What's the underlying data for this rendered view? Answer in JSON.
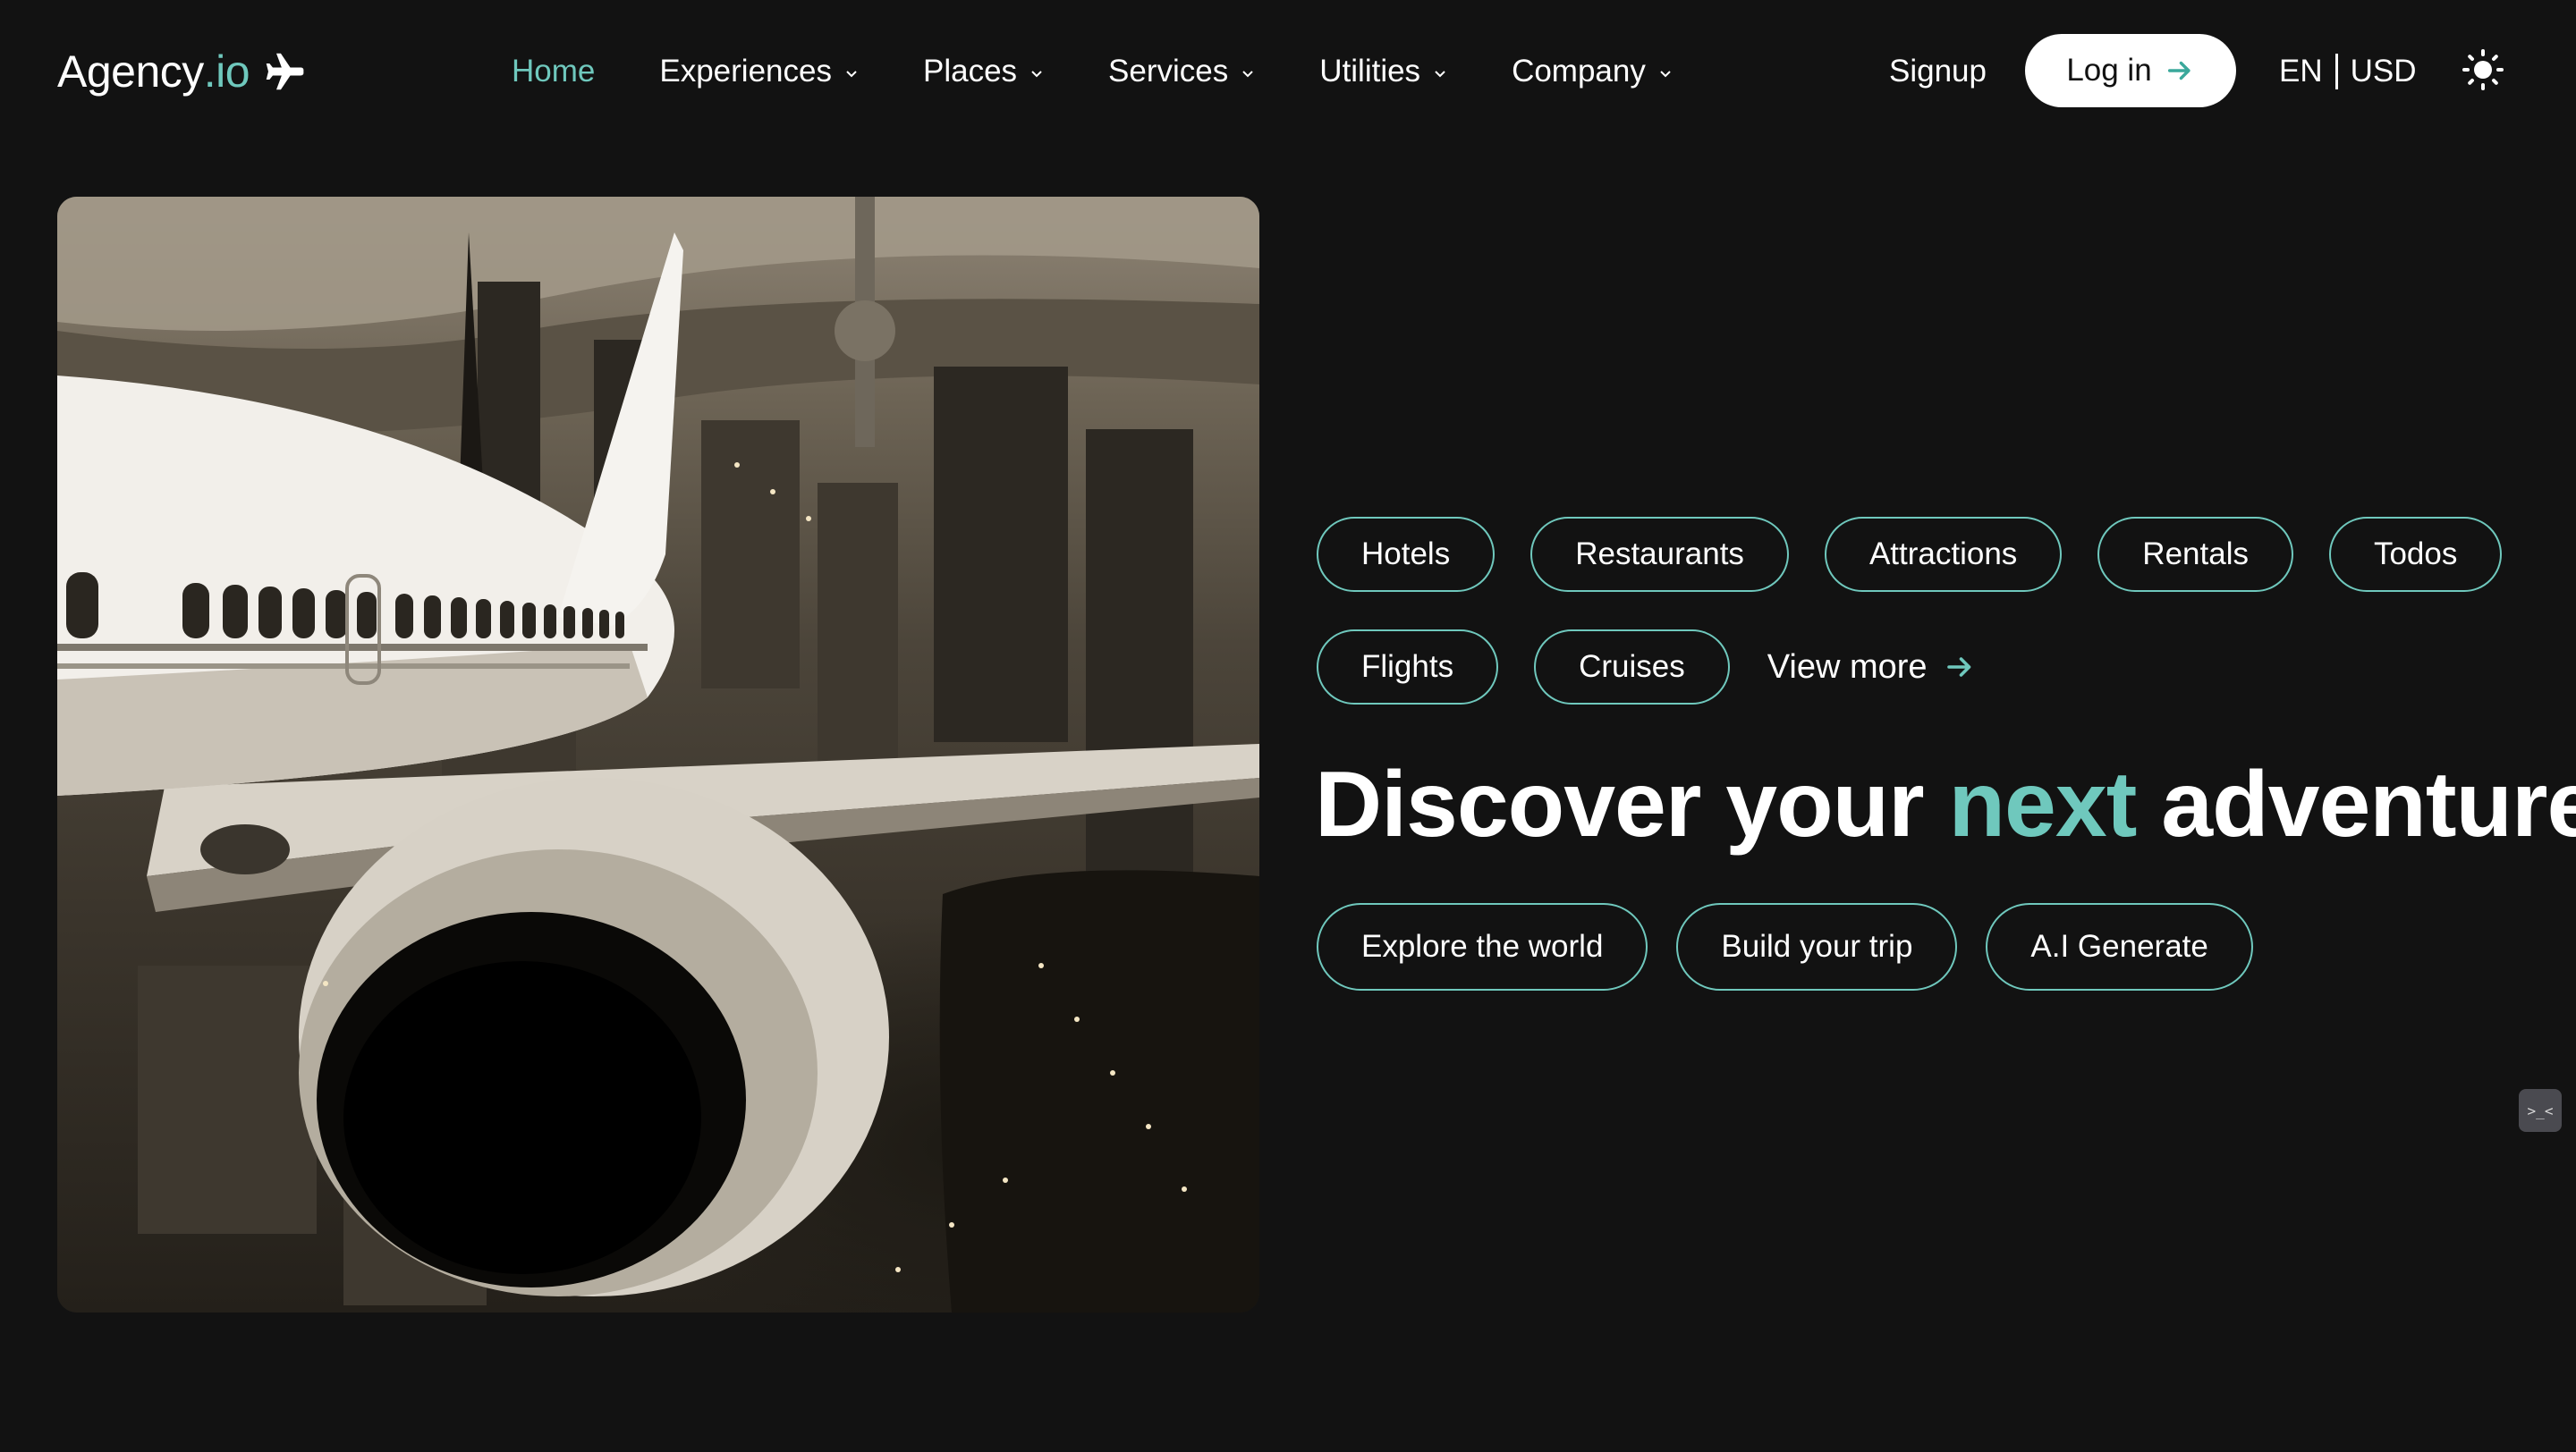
{
  "brand": {
    "name_main": "Agency",
    "name_accent": ".io",
    "icon": "airplane-icon",
    "accent_color": "#6fc8bd"
  },
  "nav": {
    "items": [
      {
        "label": "Home",
        "active": true,
        "dropdown": false
      },
      {
        "label": "Experiences",
        "active": false,
        "dropdown": true
      },
      {
        "label": "Places",
        "active": false,
        "dropdown": true
      },
      {
        "label": "Services",
        "active": false,
        "dropdown": true
      },
      {
        "label": "Utilities",
        "active": false,
        "dropdown": true
      },
      {
        "label": "Company",
        "active": false,
        "dropdown": true
      }
    ]
  },
  "auth": {
    "signup_label": "Signup",
    "login_label": "Log in"
  },
  "locale": {
    "language": "EN",
    "currency": "USD"
  },
  "theme_toggle_icon": "sun-icon",
  "hero": {
    "image_alt_icon": "airplane-over-city-photo",
    "categories_row1": [
      "Hotels",
      "Restaurants",
      "Attractions",
      "Rentals",
      "Todos"
    ],
    "categories_row2": [
      "Flights",
      "Cruises"
    ],
    "view_more_label": "View more",
    "headline_before": "Discover your ",
    "headline_accent": "next",
    "headline_after": " adventure",
    "actions": [
      "Explore the world",
      "Build your trip",
      "A.I Generate"
    ]
  },
  "floating_widget": {
    "text": ">_<"
  },
  "colors": {
    "background": "#121212",
    "accent": "#6fc8bd",
    "button_bg": "#ffffff"
  }
}
